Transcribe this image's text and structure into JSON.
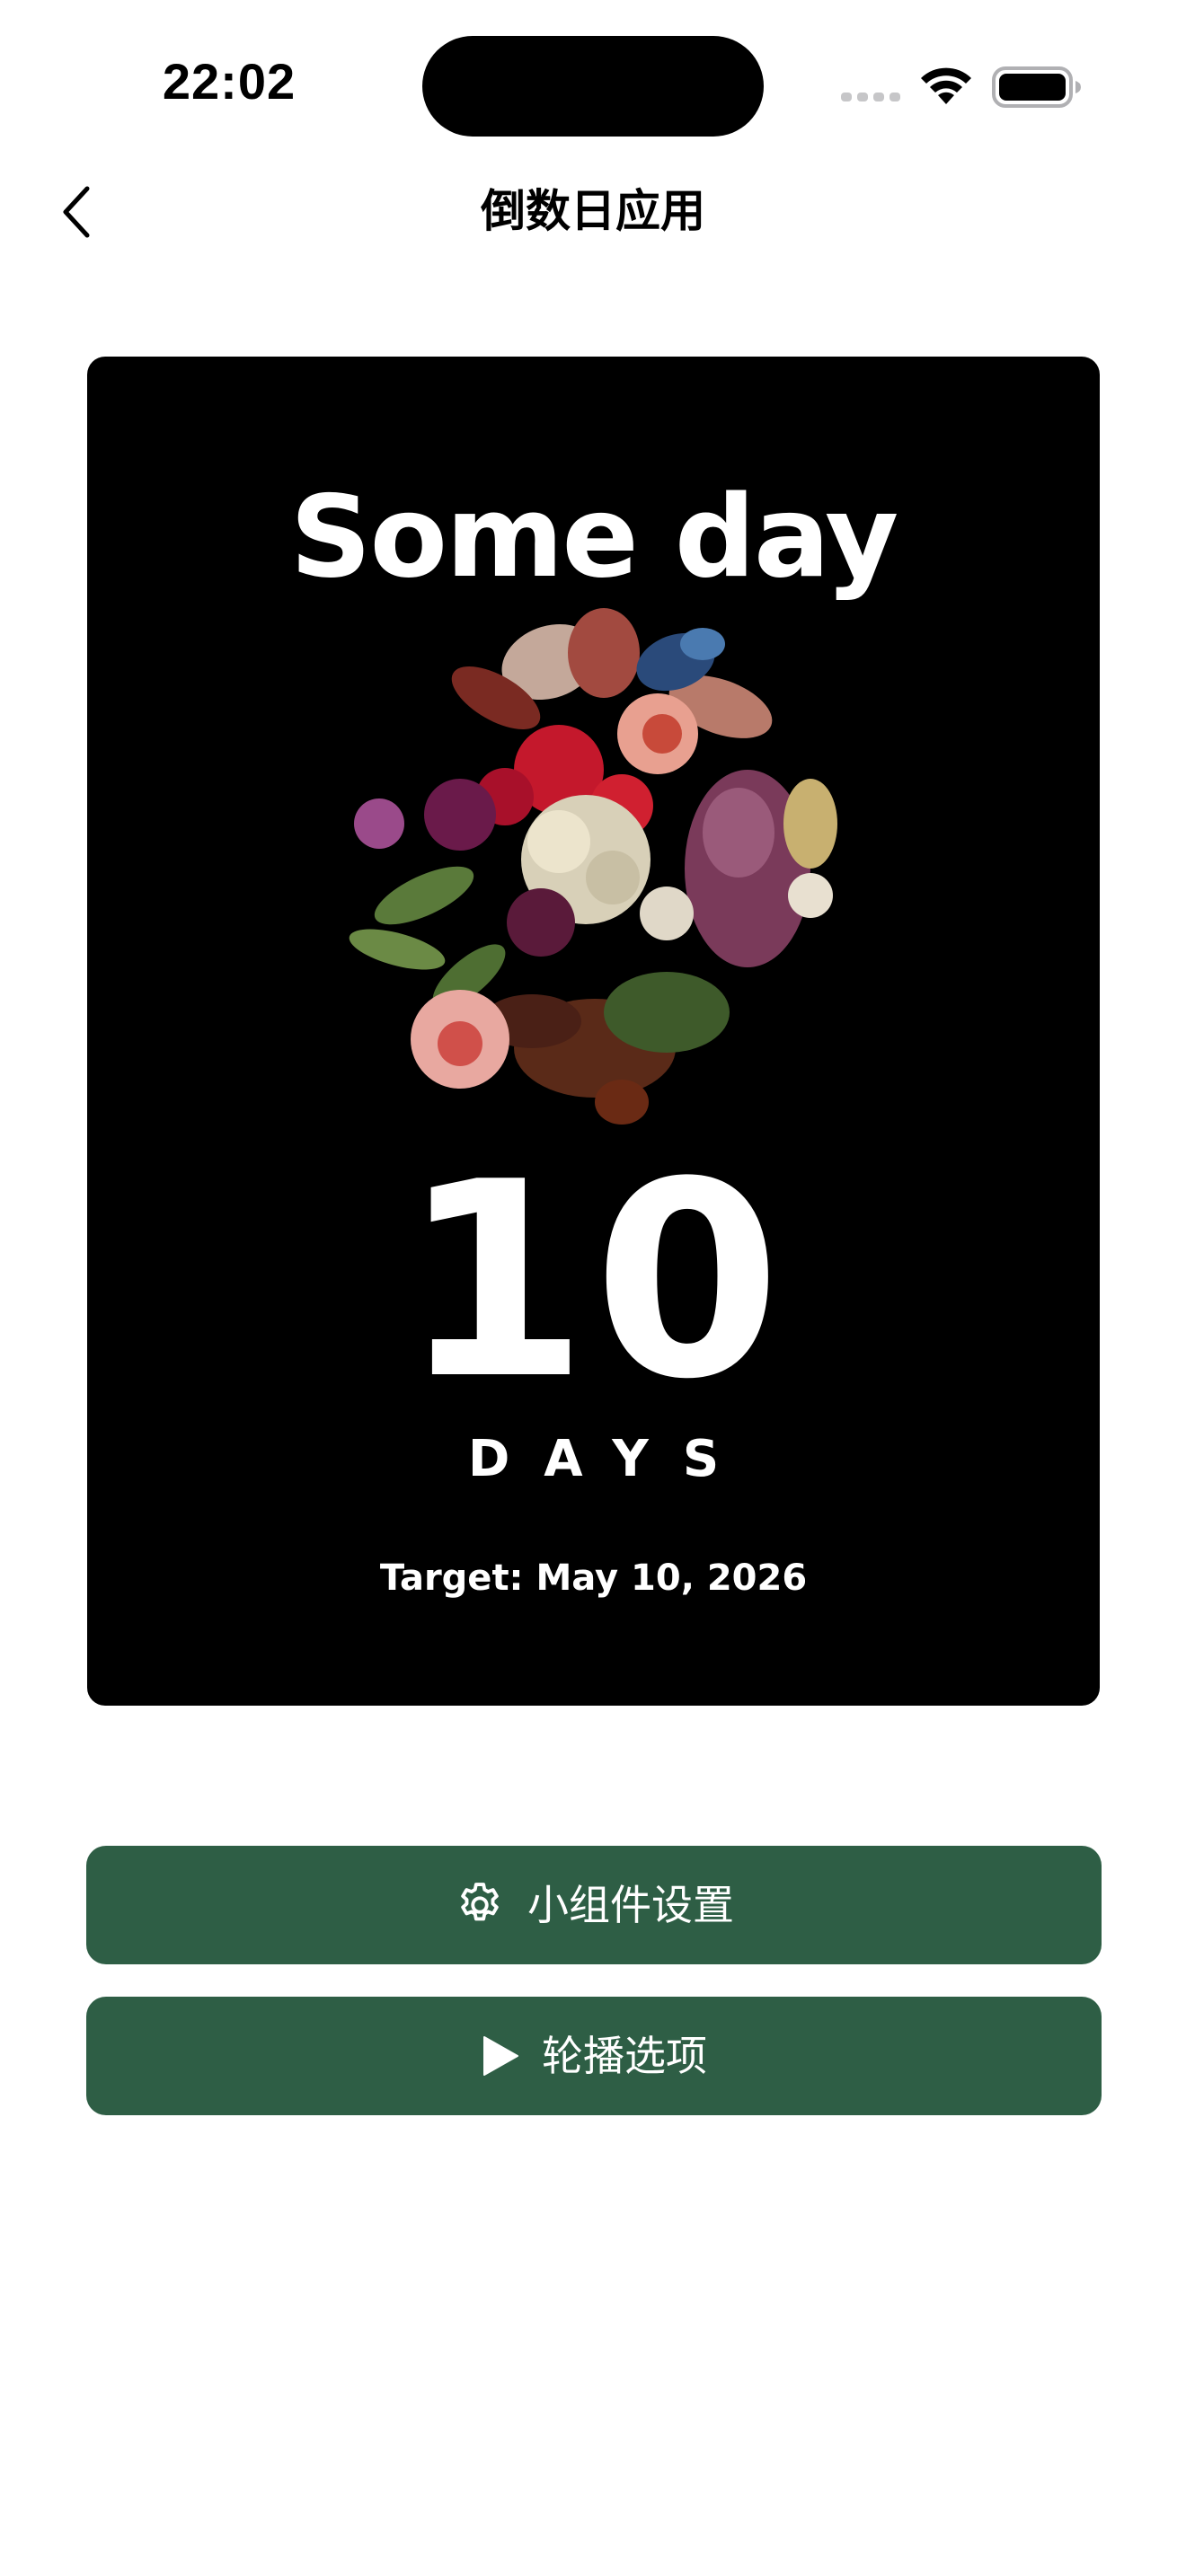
{
  "status_bar": {
    "time": "22:02",
    "icons": [
      "cellular-signal-icon",
      "wifi-icon",
      "battery-icon"
    ]
  },
  "nav": {
    "back_icon": "chevron-left-icon",
    "title": "倒数日应用"
  },
  "widget": {
    "title": "Some day",
    "count": "10",
    "unit": "DAYS",
    "target": "Target: May 10, 2026",
    "background_color": "#000000",
    "image": "flower-bouquet"
  },
  "actions": {
    "settings": {
      "icon": "gear-icon",
      "label": "小组件设置"
    },
    "carousel": {
      "icon": "play-icon",
      "label": "轮播选项"
    },
    "button_color": "#2e5e45"
  }
}
